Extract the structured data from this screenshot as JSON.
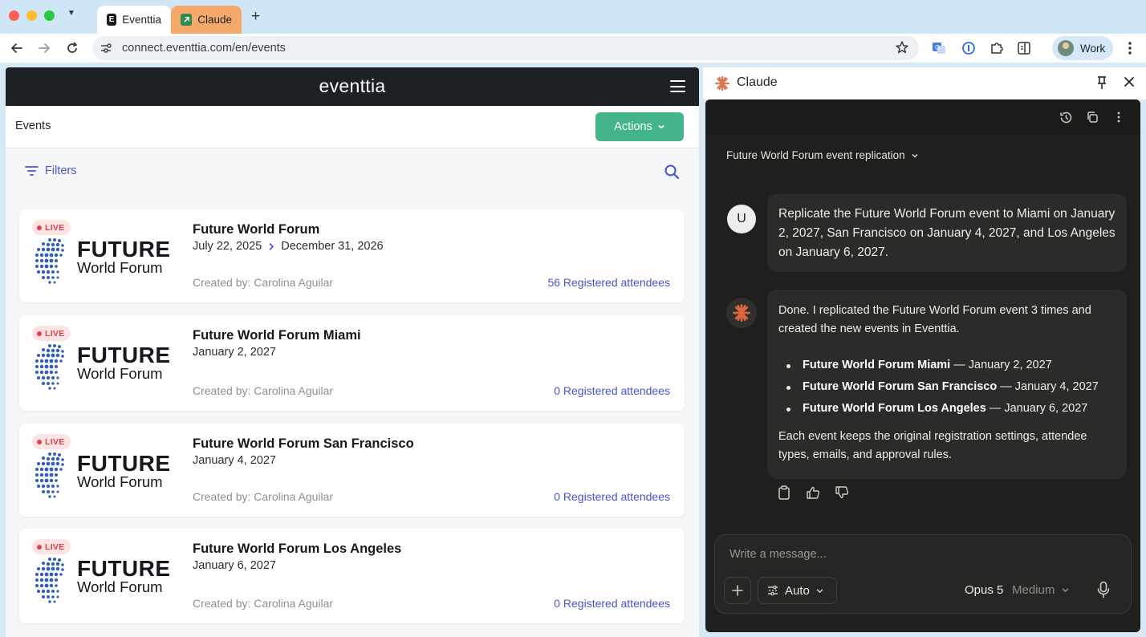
{
  "browser": {
    "tabs": [
      {
        "label": "Eventtia",
        "favicon": "E"
      },
      {
        "label": "Claude",
        "favicon": "C"
      }
    ],
    "new_tab": "+",
    "url": "connect.eventtia.com/en/events",
    "profile_label": "Work"
  },
  "eventtia": {
    "logo": "eventtia",
    "page_title": "Events",
    "actions_label": "Actions",
    "filters_label": "Filters",
    "events": [
      {
        "live": "LIVE",
        "brand_big": "FUTURE",
        "brand_small": "World Forum",
        "name": "Future World Forum",
        "start_date": "July 22, 2025",
        "end_date": "December 31, 2026",
        "created_by": "Created by: Carolina Aguilar",
        "registered": "56 Registered attendees"
      },
      {
        "live": "LIVE",
        "brand_big": "FUTURE",
        "brand_small": "World Forum",
        "name": "Future World Forum Miami",
        "start_date": "January 2, 2027",
        "created_by": "Created by: Carolina Aguilar",
        "registered": "0 Registered attendees"
      },
      {
        "live": "LIVE",
        "brand_big": "FUTURE",
        "brand_small": "World Forum",
        "name": "Future World Forum San Francisco",
        "start_date": "January 4, 2027",
        "created_by": "Created by: Carolina Aguilar",
        "registered": "0 Registered attendees"
      },
      {
        "live": "LIVE",
        "brand_big": "FUTURE",
        "brand_small": "World Forum",
        "name": "Future World Forum Los Angeles",
        "start_date": "January 6, 2027",
        "created_by": "Created by: Carolina Aguilar",
        "registered": "0 Registered attendees"
      }
    ]
  },
  "claude": {
    "title": "Claude",
    "thread_title": "Future World Forum event replication",
    "user_initial": "U",
    "user_message": "Replicate the Future World Forum event to Miami on January 2, 2027, San Francisco on January 4, 2027, and Los Angeles on January 6, 2027.",
    "reply_intro": "Done. I replicated the Future World Forum event 3 times and created the new events in Eventtia.",
    "reply_items": [
      {
        "name": "Future World Forum Miami",
        "date": " — January 2, 2027"
      },
      {
        "name": "Future World Forum San Francisco",
        "date": " — January 4, 2027"
      },
      {
        "name": "Future World Forum Los Angeles",
        "date": " — January 6, 2027"
      }
    ],
    "reply_outro": "Each event keeps the original registration settings, attendee types, emails, and approval rules.",
    "composer_placeholder": "Write a message...",
    "mode_label": "Auto",
    "model_label": "Opus 5",
    "effort_label": "Medium"
  },
  "colors": {
    "accent_green": "#44b48a",
    "link_indigo": "#4a53d1",
    "live_red": "#e2404a",
    "claude_orange": "#d97757"
  },
  "icons": [
    "back-arrow-icon",
    "forward-arrow-icon",
    "reload-icon",
    "site-settings-icon",
    "star-icon",
    "translate-icon",
    "password-icon",
    "extensions-icon",
    "sidepanel-icon",
    "kebab-icon",
    "hamburger-icon",
    "filter-icon",
    "search-icon",
    "globe-logo-icon",
    "claude-spark-icon",
    "pin-icon",
    "close-icon",
    "history-icon",
    "copy-icon",
    "more-icon",
    "clipboard-icon",
    "thumbs-up-icon",
    "thumbs-down-icon",
    "plus-icon",
    "auto-mode-icon",
    "chevron-down-icon",
    "mic-icon"
  ]
}
